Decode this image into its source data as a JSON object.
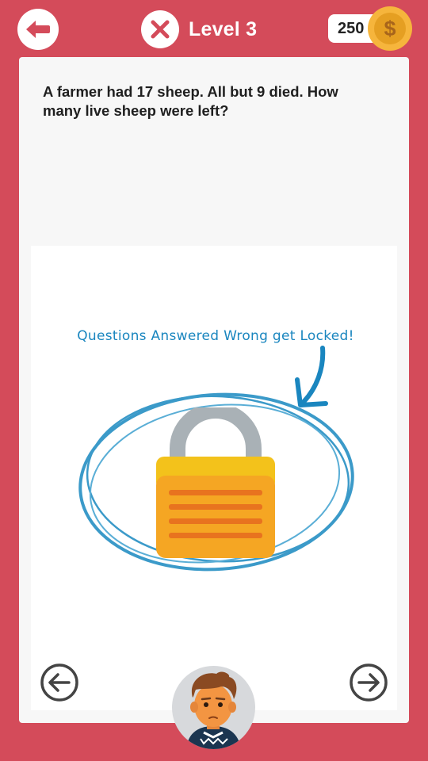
{
  "header": {
    "level_label": "Level 3",
    "coins": "250",
    "coin_symbol": "$"
  },
  "question": {
    "text": "A farmer had 17 sheep. All but 9 died. How many live sheep were left?"
  },
  "locked_notice": {
    "text": "Questions Answered Wrong get Locked!"
  },
  "colors": {
    "background": "#d44b5a",
    "card": "#f7f7f7",
    "coin": "#f6b53c",
    "notice_text": "#1a86bf",
    "lock_body": "#f5a623",
    "lock_shackle": "#a9b1b6"
  },
  "icons": {
    "back": "back-arrow-icon",
    "wrong": "close-x-icon",
    "coin": "dollar-coin-icon",
    "lock": "padlock-icon",
    "prev": "arrow-left-circle-icon",
    "next": "arrow-right-circle-icon",
    "avatar": "character-avatar"
  }
}
